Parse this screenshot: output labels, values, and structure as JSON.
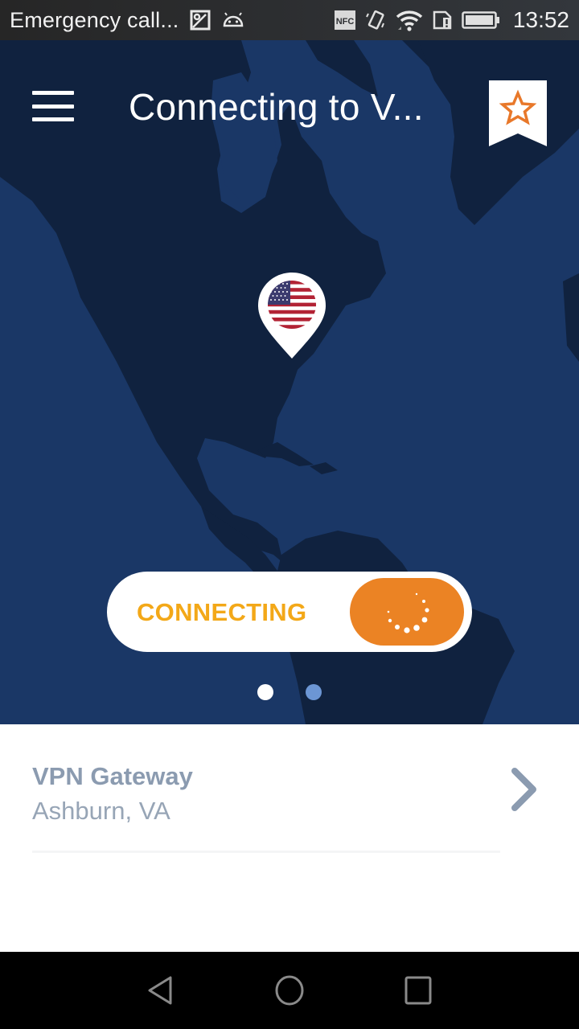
{
  "status_bar": {
    "notification_text": "Emergency call...",
    "left_icons": [
      "image-icon",
      "android-icon"
    ],
    "right_icons": [
      "nfc-icon",
      "vibrate-icon",
      "wifi-icon",
      "sim-alert-icon",
      "battery-icon"
    ],
    "time": "13:52"
  },
  "app_bar": {
    "menu_icon": "hamburger-menu-icon",
    "title": "Connecting to V...",
    "favorite_icon": "star-outline-icon"
  },
  "map": {
    "pin_flag": "united-states-flag",
    "pin_location": "Ashburn, VA"
  },
  "connect_toggle": {
    "label": "CONNECTING",
    "state": "connecting",
    "spinner_icon": "loading-spinner-icon"
  },
  "pager": {
    "page_count": 2,
    "active_page": 1
  },
  "gateway": {
    "title": "VPN Gateway",
    "location": "Ashburn, VA",
    "chevron_icon": "chevron-right-icon"
  },
  "nav_bar": {
    "back": "back-icon",
    "home": "home-icon",
    "recents": "recents-icon"
  },
  "colors": {
    "ocean": "#1a3766",
    "land": "#10223f",
    "accent_orange": "#eb8324",
    "label_yellow": "#f3a818",
    "pager_inactive": "#6c96d4",
    "gateway_text": "#8b9bb0"
  }
}
